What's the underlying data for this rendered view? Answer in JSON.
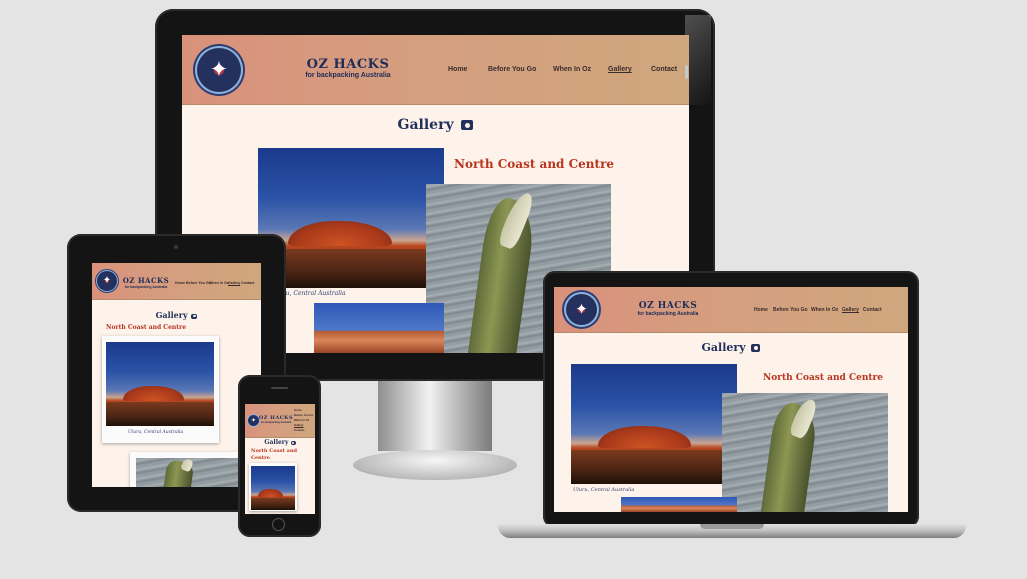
{
  "site": {
    "title": "OZ HACKS",
    "subtitle": "for backpacking Australia",
    "nav": [
      "Home",
      "Before You Go",
      "When In Oz",
      "Gallery",
      "Contact"
    ],
    "active_nav": "Gallery",
    "page_heading": "Gallery",
    "section_heading": "North Coast and Centre",
    "photo_caption": "Uluru, Central Australia",
    "mobile_section_line1": "North Coast and",
    "mobile_section_line2": "Centre"
  },
  "icons": {
    "logo": "compass-rose-icon",
    "heading": "camera-icon"
  },
  "colors": {
    "header_start": "#d9917c",
    "header_end": "#cfa77e",
    "page_background": "#fdf3ea",
    "heading_navy": "#23305c",
    "section_red": "#b8341e"
  }
}
